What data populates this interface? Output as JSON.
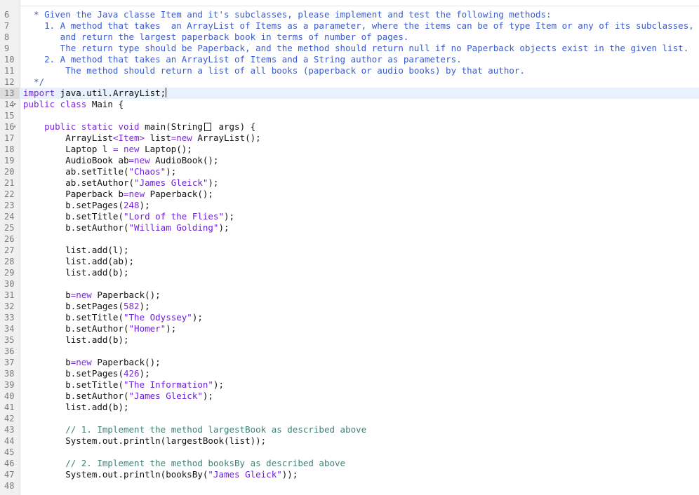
{
  "editor": {
    "lines": [
      {
        "n": "6",
        "segs": [
          {
            "t": "  * Given the Java classe Item and it's subclasses, please implement and test the following methods:",
            "c": "cmt"
          }
        ]
      },
      {
        "n": "7",
        "segs": [
          {
            "t": "    1. A method that takes  an ArrayList of Items as a parameter, where the items can be of type Item or any of its subclasses,",
            "c": "cmt"
          }
        ]
      },
      {
        "n": "8",
        "segs": [
          {
            "t": "       and return the largest paperback book in terms of number of pages.",
            "c": "cmt"
          }
        ]
      },
      {
        "n": "9",
        "segs": [
          {
            "t": "       The return type should be Paperback, and the method should return null if no Paperback objects exist in the given list.",
            "c": "cmt"
          }
        ]
      },
      {
        "n": "10",
        "segs": [
          {
            "t": "    2. A method that takes an ArrayList of Items and a String author as parameters.",
            "c": "cmt"
          }
        ]
      },
      {
        "n": "11",
        "segs": [
          {
            "t": "        The method should return a list of all books (paperback or audio books) by that author.",
            "c": "cmt"
          }
        ]
      },
      {
        "n": "12",
        "segs": [
          {
            "t": "  */",
            "c": "cmt"
          }
        ]
      },
      {
        "n": "13",
        "active": true,
        "segs": [
          {
            "t": "import",
            "c": "kw"
          },
          {
            "t": " java.util.ArrayList;",
            "c": ""
          }
        ]
      },
      {
        "n": "14",
        "fold": true,
        "segs": [
          {
            "t": "public class",
            "c": "kw"
          },
          {
            "t": " Main {",
            "c": ""
          }
        ]
      },
      {
        "n": "15",
        "segs": []
      },
      {
        "n": "16",
        "fold": true,
        "segs": [
          {
            "t": "    ",
            "c": ""
          },
          {
            "t": "public static void",
            "c": "kw"
          },
          {
            "t": " main(String",
            "c": ""
          },
          {
            "t": "[]",
            "c": "box"
          },
          {
            "t": " args) {",
            "c": ""
          }
        ]
      },
      {
        "n": "17",
        "segs": [
          {
            "t": "        ArrayList",
            "c": ""
          },
          {
            "t": "<Item>",
            "c": "kw"
          },
          {
            "t": " list",
            "c": ""
          },
          {
            "t": "=new",
            "c": "kw"
          },
          {
            "t": " ArrayList();",
            "c": ""
          }
        ]
      },
      {
        "n": "18",
        "segs": [
          {
            "t": "        Laptop l ",
            "c": ""
          },
          {
            "t": "= new",
            "c": "kw"
          },
          {
            "t": " Laptop();",
            "c": ""
          }
        ]
      },
      {
        "n": "19",
        "segs": [
          {
            "t": "        AudioBook ab",
            "c": ""
          },
          {
            "t": "=new",
            "c": "kw"
          },
          {
            "t": " AudioBook();",
            "c": ""
          }
        ]
      },
      {
        "n": "20",
        "segs": [
          {
            "t": "        ab.setTitle(",
            "c": ""
          },
          {
            "t": "\"Chaos\"",
            "c": "str"
          },
          {
            "t": ");",
            "c": ""
          }
        ]
      },
      {
        "n": "21",
        "segs": [
          {
            "t": "        ab.setAuthor(",
            "c": ""
          },
          {
            "t": "\"James Gleick\"",
            "c": "str"
          },
          {
            "t": ");",
            "c": ""
          }
        ]
      },
      {
        "n": "22",
        "segs": [
          {
            "t": "        Paperback b",
            "c": ""
          },
          {
            "t": "=new",
            "c": "kw"
          },
          {
            "t": " Paperback();",
            "c": ""
          }
        ]
      },
      {
        "n": "23",
        "segs": [
          {
            "t": "        b.setPages(",
            "c": ""
          },
          {
            "t": "248",
            "c": "num"
          },
          {
            "t": ");",
            "c": ""
          }
        ]
      },
      {
        "n": "24",
        "segs": [
          {
            "t": "        b.setTitle(",
            "c": ""
          },
          {
            "t": "\"Lord of the Flies\"",
            "c": "str"
          },
          {
            "t": ");",
            "c": ""
          }
        ]
      },
      {
        "n": "25",
        "segs": [
          {
            "t": "        b.setAuthor(",
            "c": ""
          },
          {
            "t": "\"William Golding\"",
            "c": "str"
          },
          {
            "t": ");",
            "c": ""
          }
        ]
      },
      {
        "n": "26",
        "segs": []
      },
      {
        "n": "27",
        "segs": [
          {
            "t": "        list.add(l);",
            "c": ""
          }
        ]
      },
      {
        "n": "28",
        "segs": [
          {
            "t": "        list.add(ab);",
            "c": ""
          }
        ]
      },
      {
        "n": "29",
        "segs": [
          {
            "t": "        list.add(b);",
            "c": ""
          }
        ]
      },
      {
        "n": "30",
        "segs": []
      },
      {
        "n": "31",
        "segs": [
          {
            "t": "        b",
            "c": ""
          },
          {
            "t": "=new",
            "c": "kw"
          },
          {
            "t": " Paperback();",
            "c": ""
          }
        ]
      },
      {
        "n": "32",
        "segs": [
          {
            "t": "        b.setPages(",
            "c": ""
          },
          {
            "t": "582",
            "c": "num"
          },
          {
            "t": ");",
            "c": ""
          }
        ]
      },
      {
        "n": "33",
        "segs": [
          {
            "t": "        b.setTitle(",
            "c": ""
          },
          {
            "t": "\"The Odyssey\"",
            "c": "str"
          },
          {
            "t": ");",
            "c": ""
          }
        ]
      },
      {
        "n": "34",
        "segs": [
          {
            "t": "        b.setAuthor(",
            "c": ""
          },
          {
            "t": "\"Homer\"",
            "c": "str"
          },
          {
            "t": ");",
            "c": ""
          }
        ]
      },
      {
        "n": "35",
        "segs": [
          {
            "t": "        list.add(b);",
            "c": ""
          }
        ]
      },
      {
        "n": "36",
        "segs": []
      },
      {
        "n": "37",
        "segs": [
          {
            "t": "        b",
            "c": ""
          },
          {
            "t": "=new",
            "c": "kw"
          },
          {
            "t": " Paperback();",
            "c": ""
          }
        ]
      },
      {
        "n": "38",
        "segs": [
          {
            "t": "        b.setPages(",
            "c": ""
          },
          {
            "t": "426",
            "c": "num"
          },
          {
            "t": ");",
            "c": ""
          }
        ]
      },
      {
        "n": "39",
        "segs": [
          {
            "t": "        b.setTitle(",
            "c": ""
          },
          {
            "t": "\"The Information\"",
            "c": "str"
          },
          {
            "t": ");",
            "c": ""
          }
        ]
      },
      {
        "n": "40",
        "segs": [
          {
            "t": "        b.setAuthor(",
            "c": ""
          },
          {
            "t": "\"James Gleick\"",
            "c": "str"
          },
          {
            "t": ");",
            "c": ""
          }
        ]
      },
      {
        "n": "41",
        "segs": [
          {
            "t": "        list.add(b);",
            "c": ""
          }
        ]
      },
      {
        "n": "42",
        "segs": []
      },
      {
        "n": "43",
        "segs": [
          {
            "t": "        // 1. Implement the method largestBook as described above",
            "c": "lc"
          }
        ]
      },
      {
        "n": "44",
        "segs": [
          {
            "t": "        System.out.println(largestBook(list));",
            "c": ""
          }
        ]
      },
      {
        "n": "45",
        "segs": []
      },
      {
        "n": "46",
        "segs": [
          {
            "t": "        // 2. Implement the method booksBy as described above",
            "c": "lc"
          }
        ]
      },
      {
        "n": "47",
        "segs": [
          {
            "t": "        System.out.println(booksBy(",
            "c": ""
          },
          {
            "t": "\"James Gleick\"",
            "c": "str"
          },
          {
            "t": "));",
            "c": ""
          }
        ]
      },
      {
        "n": "48",
        "segs": []
      }
    ]
  },
  "colors": {
    "comment": "#3b5bcc",
    "line_comment": "#3f7f74",
    "keyword": "#7a2bd1",
    "string": "#6b1fd6",
    "active_line": "#e8f2fe"
  },
  "icons": {
    "fold": "fold-arrow-icon"
  }
}
